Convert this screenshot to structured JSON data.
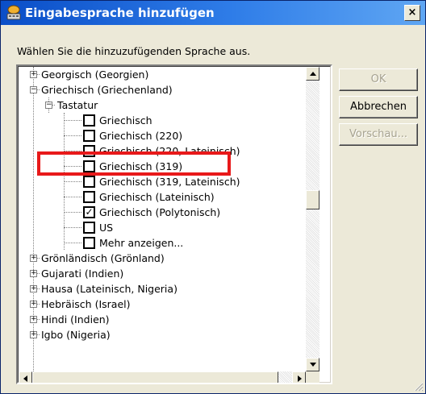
{
  "window": {
    "title": "Eingabesprache hinzufügen",
    "close_label": "×"
  },
  "prompt": "Wählen Sie die hinzuzufügenden Sprache aus.",
  "buttons": {
    "ok": "OK",
    "cancel": "Abbrechen",
    "preview": "Vorschau..."
  },
  "tree": {
    "georgian": "Georgisch (Georgien)",
    "greek": "Griechisch (Griechenland)",
    "keyboard": "Tastatur",
    "layouts": [
      {
        "label": "Griechisch",
        "checked": false
      },
      {
        "label": "Griechisch (220)",
        "checked": false
      },
      {
        "label": "Griechisch (220, Lateinisch)",
        "checked": false
      },
      {
        "label": "Griechisch (319)",
        "checked": false
      },
      {
        "label": "Griechisch (319, Lateinisch)",
        "checked": false
      },
      {
        "label": "Griechisch (Lateinisch)",
        "checked": false
      },
      {
        "label": "Griechisch (Polytonisch)",
        "checked": true
      },
      {
        "label": "US",
        "checked": false
      },
      {
        "label": "Mehr anzeigen...",
        "checked": false
      }
    ],
    "languages_after": [
      "Grönländisch (Grönland)",
      "Gujarati (Indien)",
      "Hausa (Lateinisch, Nigeria)",
      "Hebräisch (Israel)",
      "Hindi (Indien)",
      "Igbo (Nigeria)"
    ]
  },
  "colors": {
    "titlebar": "#0a4ec8",
    "highlight": "#e8191a",
    "dialog": "#ece9d8"
  }
}
